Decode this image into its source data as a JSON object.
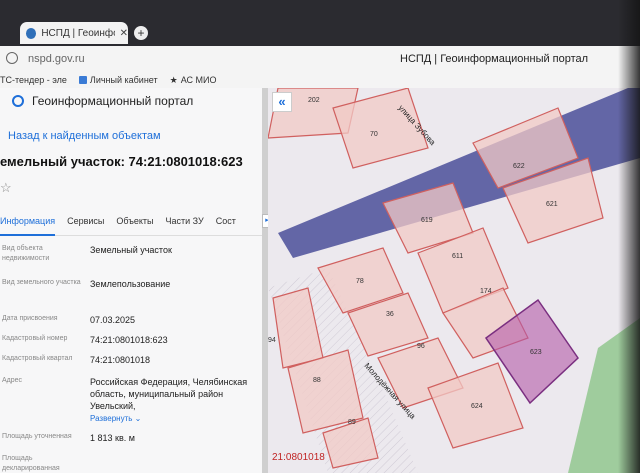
{
  "browser": {
    "tab_title": "НСПД | Геоинформацио...",
    "url": "nspd.gov.ru",
    "page_title": "НСПД | Геоинформационный портал",
    "bookmarks": [
      {
        "label": "ТС-тендер - эле",
        "icon": "link-icon"
      },
      {
        "label": "Личный кабинет",
        "icon": "folder-icon"
      },
      {
        "label": "АС МИО",
        "icon": "star-icon"
      }
    ]
  },
  "panel": {
    "brand": "Геоинформационный портал",
    "back_link": "Назад к найденным объектам",
    "object_title": "емельный участок: 74:21:0801018:623",
    "tabs": [
      "Информация",
      "Сервисы",
      "Объекты",
      "Части ЗУ",
      "Сост"
    ],
    "attributes": [
      {
        "label": "Вид объекта недвижимости",
        "value": "Земельный участок"
      },
      {
        "label": "Вид земельного участка",
        "value": "Землепользование"
      },
      {
        "label": "Дата присвоения",
        "value": "07.03.2025"
      },
      {
        "label": "Кадастровый номер",
        "value": "74:21:0801018:623"
      },
      {
        "label": "Кадастровый квартал",
        "value": "74:21:0801018"
      },
      {
        "label": "Адрес",
        "value": "Российская Федерация, Челябинская область, муниципальный район Увельский,"
      },
      {
        "label": "Площадь уточненная",
        "value": "1 813 кв. м"
      },
      {
        "label": "Площадь декларированная",
        "value": ""
      }
    ],
    "expand_link": "Развернуть",
    "colors": {
      "accent": "#1e6fd9"
    }
  },
  "map": {
    "streets": [
      "улица Зубова",
      "Молодёжная улица"
    ],
    "parcels": [
      "202",
      "70",
      "622",
      "621",
      "619",
      "611",
      "78",
      "174",
      "36",
      "96",
      "623",
      "88",
      "624",
      "89",
      "94"
    ],
    "quarter_label": "21:0801018",
    "colors": {
      "parcel": "#e07a7a",
      "selected": "#8b3f95",
      "road": "#4b4f99"
    }
  }
}
